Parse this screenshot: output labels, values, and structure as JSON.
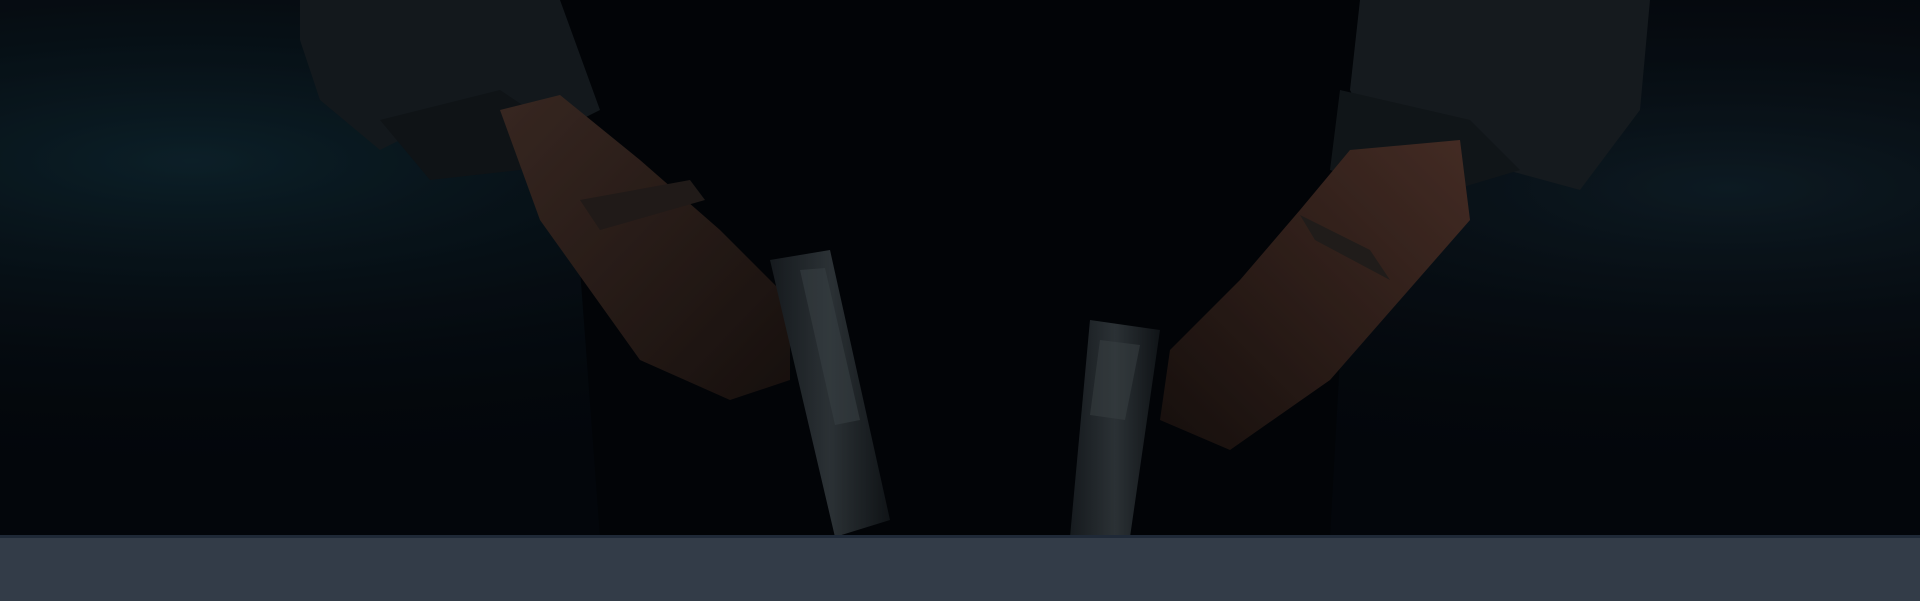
{
  "hero": {
    "image_description_icon": "hero-artwork-icon",
    "colors": {
      "background": "#05090f",
      "smoke": "#0e2430",
      "sleeve": "#1b2227",
      "skin": "#3a2a24",
      "metal": "#2a3036"
    }
  },
  "footer_bar": {
    "color": "#333c48"
  }
}
